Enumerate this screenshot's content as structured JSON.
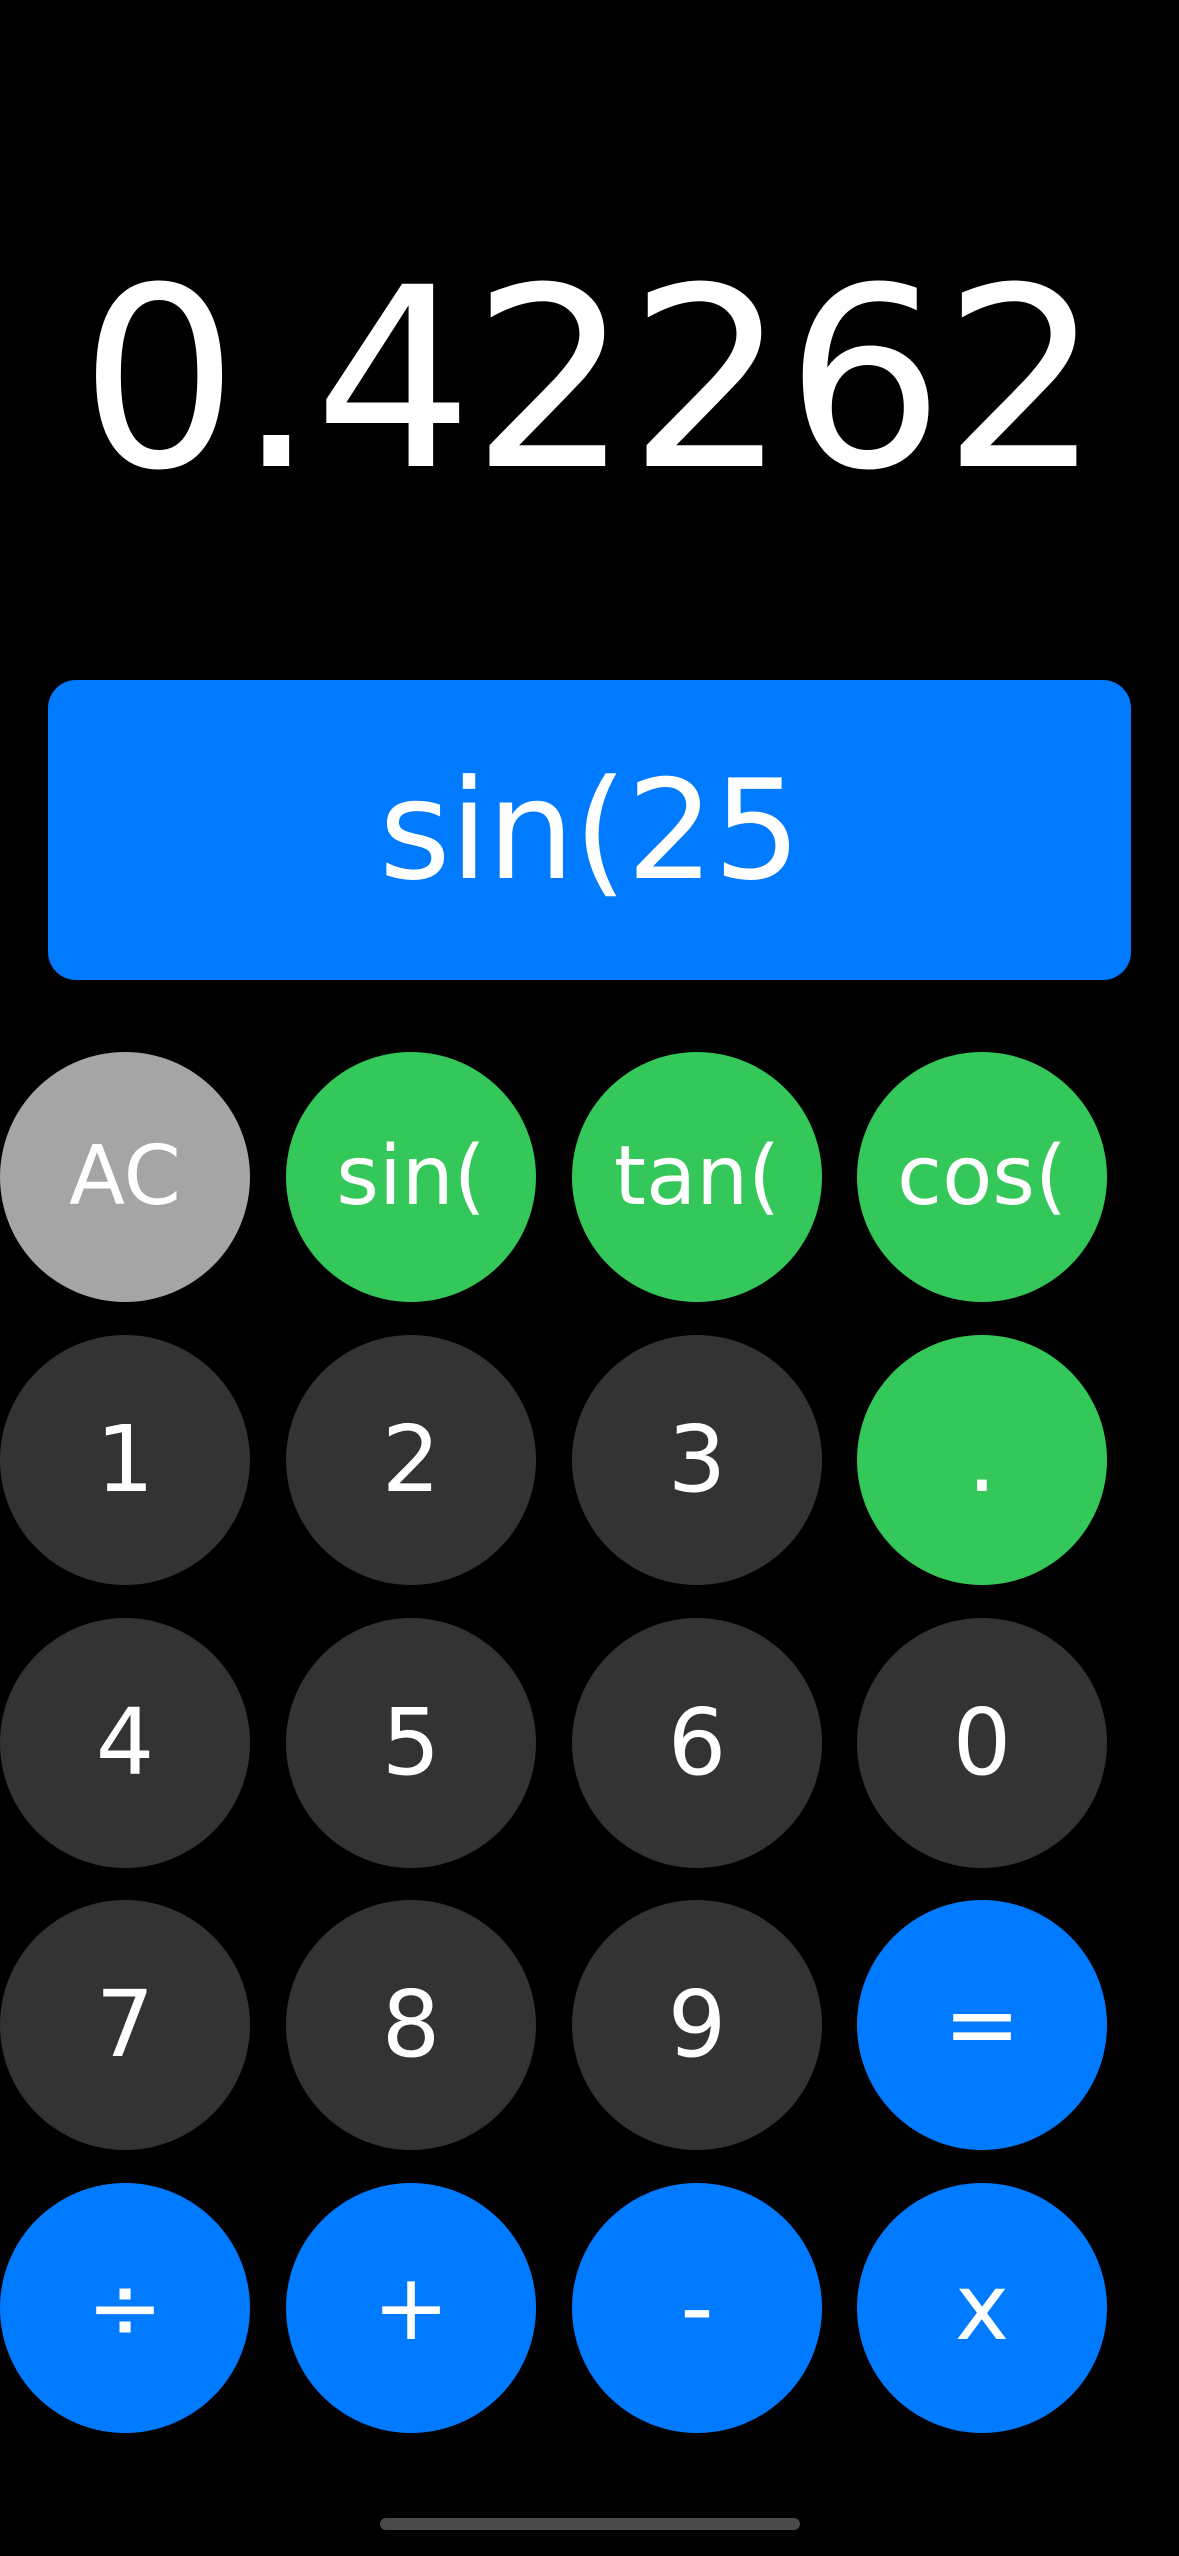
{
  "display": {
    "result": "0.42262"
  },
  "expression": {
    "text": "sin(25"
  },
  "buttons": {
    "ac": "AC",
    "sin": "sin(",
    "tan": "tan(",
    "cos": "cos(",
    "one": "1",
    "two": "2",
    "three": "3",
    "dot": ".",
    "four": "4",
    "five": "5",
    "six": "6",
    "zero": "0",
    "seven": "7",
    "eight": "8",
    "nine": "9",
    "equals": "=",
    "divide": "÷",
    "plus": "+",
    "minus": "-",
    "multiply": "x"
  },
  "colors": {
    "background": "#000000",
    "blue": "#007AFF",
    "green": "#34C759",
    "dark": "#333333",
    "gray": "#A5A5A5",
    "text": "#FFFFFF"
  }
}
